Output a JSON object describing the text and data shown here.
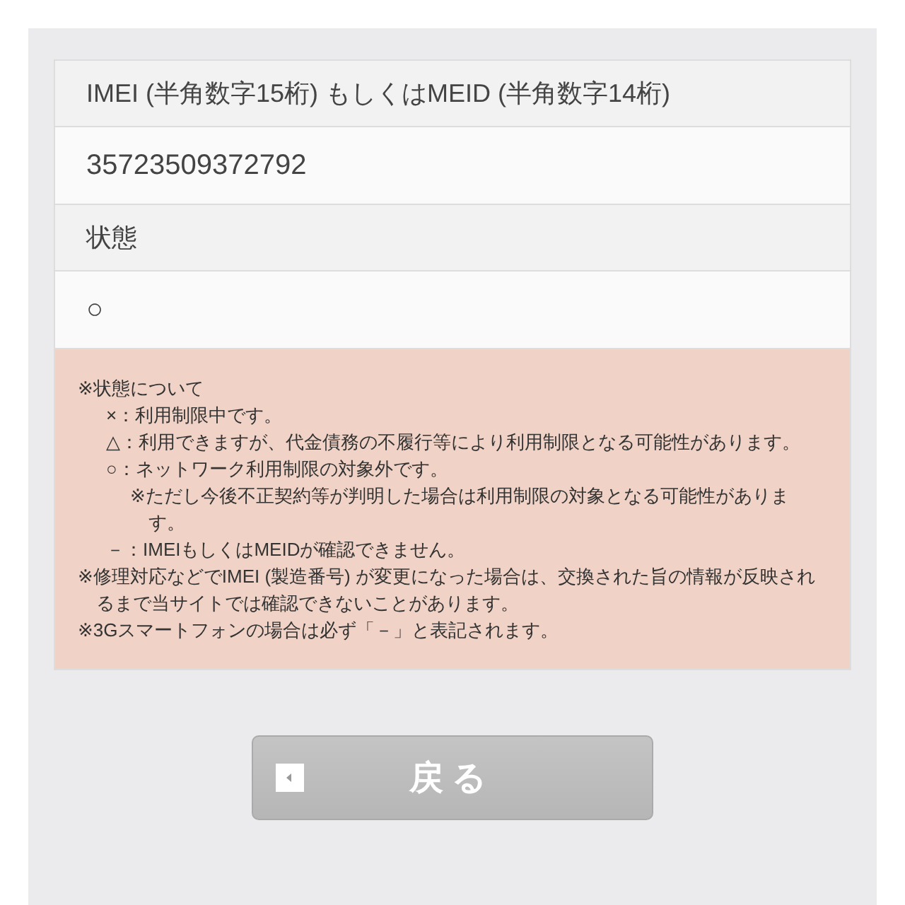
{
  "fields": [
    {
      "label": "IMEI (半角数字15桁) もしくはMEID (半角数字14桁)",
      "value": "35723509372792"
    },
    {
      "label": "状態",
      "value": "○"
    }
  ],
  "notes": [
    {
      "text": "※状態について",
      "children": [
        {
          "text": "×：利用制限中です。"
        },
        {
          "text": "△：利用できますが、代金債務の不履行等により利用制限となる可能性があります。"
        },
        {
          "text": "○：ネットワーク利用制限の対象外です。",
          "children": [
            {
              "text": "※ただし今後不正契約等が判明した場合は利用制限の対象となる可能性があります。"
            }
          ]
        },
        {
          "text": "－：IMEIもしくはMEIDが確認できません。"
        }
      ]
    },
    {
      "text": "※修理対応などでIMEI (製造番号) が変更になった場合は、交換された旨の情報が反映されるまで当サイトでは確認できないことがあります。"
    },
    {
      "text": "※3Gスマートフォンの場合は必ず「－」と表記されます。"
    }
  ],
  "back_button": {
    "label": "戻る"
  }
}
